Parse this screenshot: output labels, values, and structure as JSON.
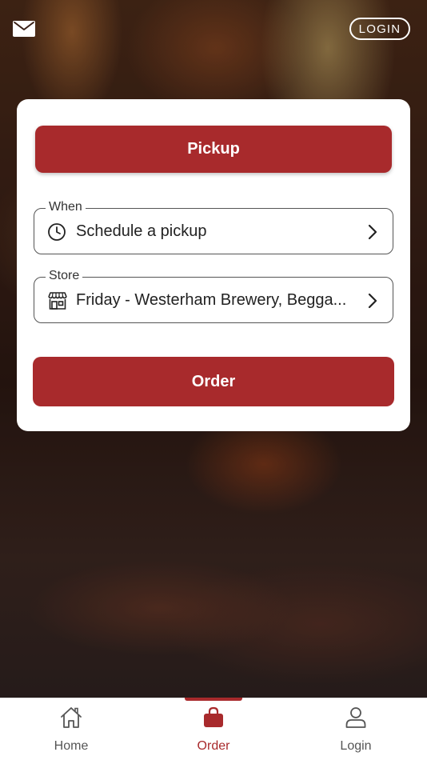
{
  "header": {
    "mail_icon": "envelope-icon",
    "login_label": "LOGIN"
  },
  "card": {
    "pickup_label": "Pickup",
    "when": {
      "label": "When",
      "value": "Schedule a pickup",
      "icon": "clock-icon"
    },
    "store": {
      "label": "Store",
      "value": "Friday - Westerham Brewery, Begga...",
      "icon": "storefront-icon"
    },
    "order_label": "Order"
  },
  "tabbar": {
    "tabs": [
      {
        "label": "Home",
        "icon": "home-icon"
      },
      {
        "label": "Order",
        "icon": "shopping-bag-icon"
      },
      {
        "label": "Login",
        "icon": "person-icon"
      }
    ],
    "active_index": 1
  },
  "colors": {
    "accent": "#a82a2c",
    "card_bg": "#ffffff",
    "tab_inactive": "#555555"
  }
}
